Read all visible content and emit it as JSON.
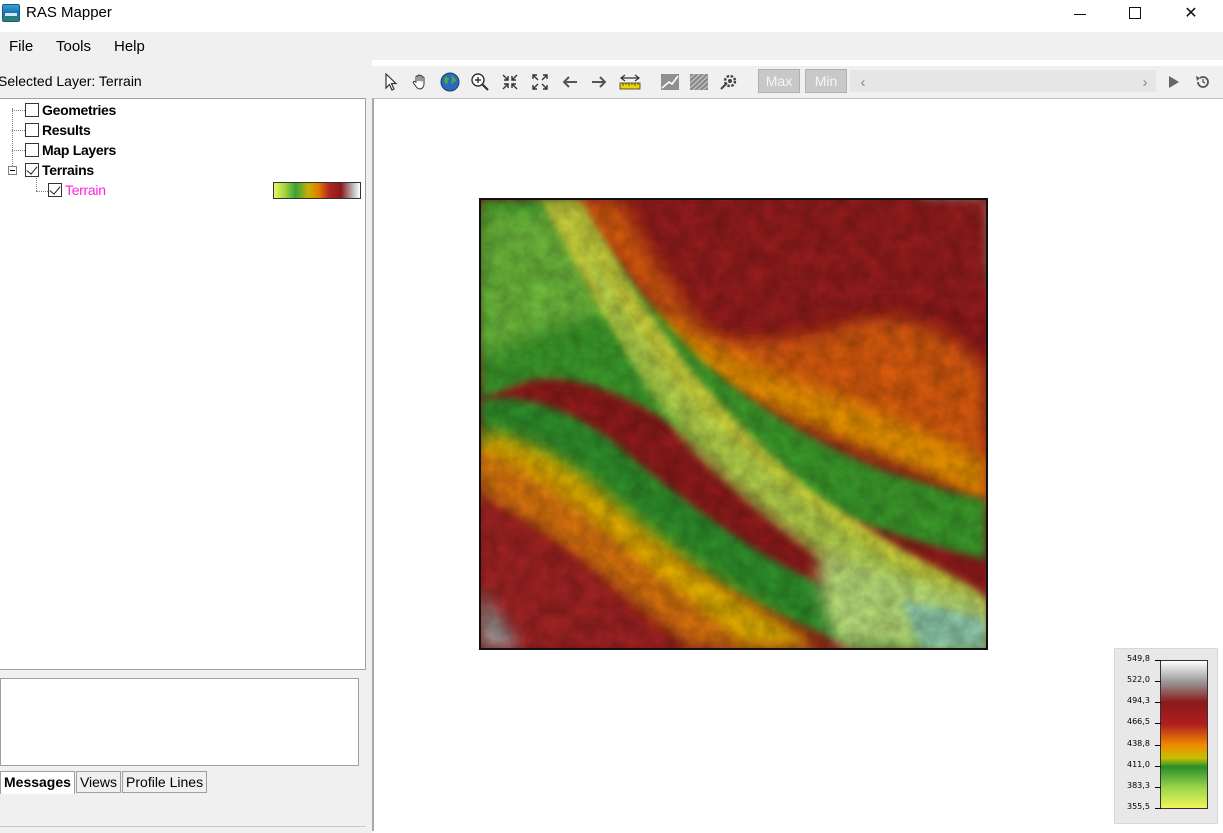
{
  "window": {
    "title": "RAS Mapper"
  },
  "menu": {
    "items": [
      "File",
      "Tools",
      "Help"
    ]
  },
  "layers": {
    "selected_label": "Selected Layer: Terrain",
    "tree": [
      {
        "label": "Geometries",
        "checked": false
      },
      {
        "label": "Results",
        "checked": false
      },
      {
        "label": "Map Layers",
        "checked": false
      },
      {
        "label": "Terrains",
        "checked": true
      },
      {
        "label": "Terrain",
        "checked": true
      }
    ]
  },
  "bottom_tabs": [
    "Messages",
    "Views",
    "Profile Lines"
  ],
  "toolbar": {
    "max_label": "Max",
    "min_label": "Min",
    "icons": [
      "pointer-icon",
      "pan-hand-icon",
      "globe-icon",
      "zoom-in-icon",
      "zoom-out-icon",
      "full-extent-icon",
      "back-arrow-icon",
      "forward-arrow-icon",
      "measure-ruler-icon",
      "terrain-profile-icon",
      "hillshade-icon",
      "settings-icon",
      "scroll-left-icon",
      "scroll-right-icon",
      "play-icon",
      "reset-icon"
    ]
  },
  "elevation_legend": {
    "ticks": [
      "549,8",
      "522,0",
      "494,3",
      "466,5",
      "438,8",
      "411,0",
      "383,3",
      "355,5"
    ]
  },
  "colors": {
    "terrain_label": "#ff22dd",
    "toolbar_bg": "#f0f0f0"
  }
}
